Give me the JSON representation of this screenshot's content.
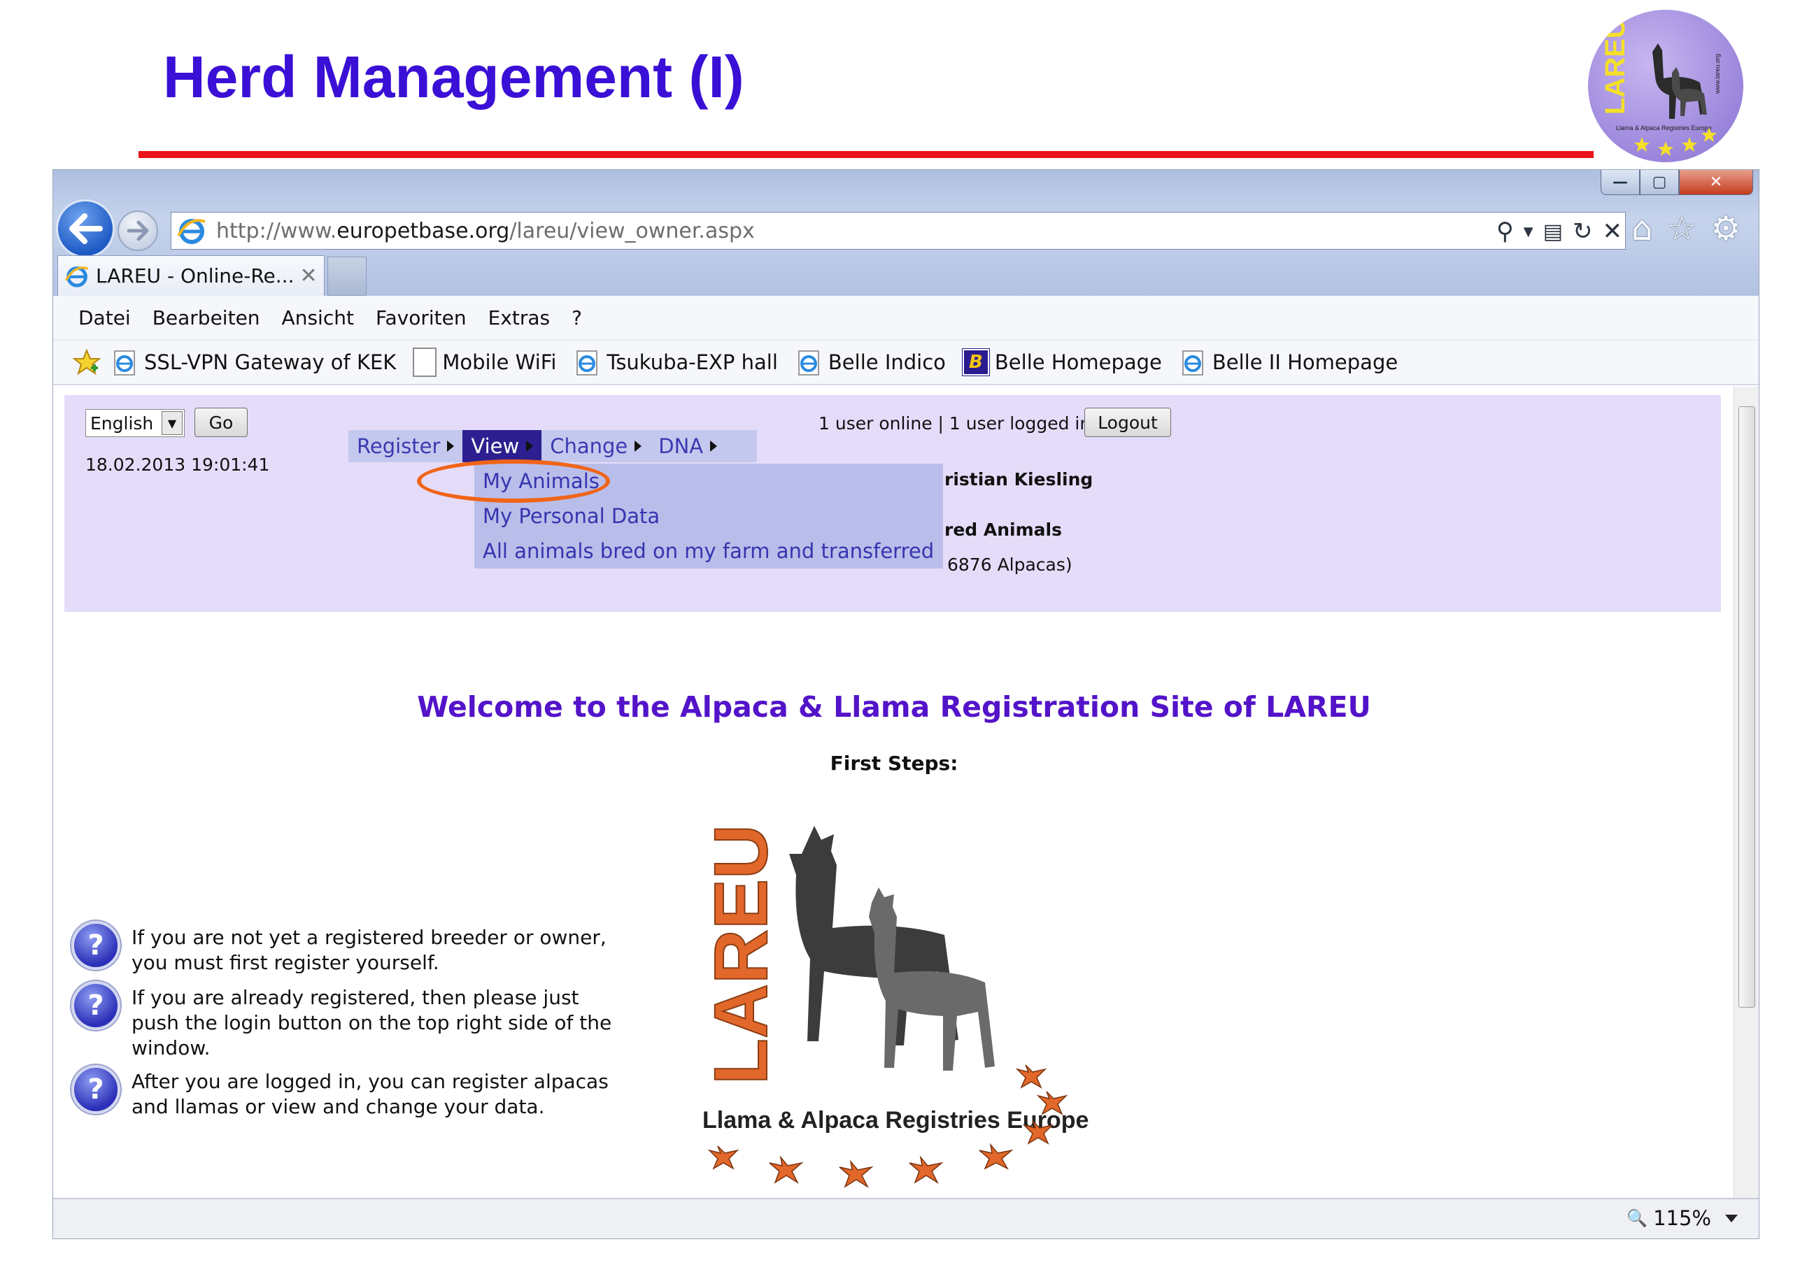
{
  "slide": {
    "title": "Herd Management (I)",
    "badge_text": "LAREU",
    "badge_subtext": "Llama & Alpaca Registries Europe",
    "badge_url": "www.lareu.org"
  },
  "window": {
    "min_label": "—",
    "max_label": "▢",
    "close_label": "✕"
  },
  "address": {
    "url_prefix": "http://www.",
    "url_domain": "europetbase.org",
    "url_path": "/lareu/view_owner.aspx"
  },
  "tab": {
    "title": "LAREU - Online-Re...",
    "close": "✕"
  },
  "menubar": {
    "items": [
      "Datei",
      "Bearbeiten",
      "Ansicht",
      "Favoriten",
      "Extras",
      "?"
    ]
  },
  "favorites": {
    "items": [
      {
        "label": "SSL-VPN Gateway of KEK",
        "icon": "ie-page-icon"
      },
      {
        "label": "Mobile WiFi",
        "icon": "blank-page-icon"
      },
      {
        "label": "Tsukuba-EXP hall",
        "icon": "ie-page-icon"
      },
      {
        "label": "Belle Indico",
        "icon": "ie-page-icon"
      },
      {
        "label": "Belle Homepage",
        "icon": "belle-b-icon"
      },
      {
        "label": "Belle II Homepage",
        "icon": "ie-page-icon"
      }
    ]
  },
  "header": {
    "language": "English",
    "go_label": "Go",
    "datetime": "18.02.2013 19:01:41",
    "users_online": "1 user online | 1 user logged in",
    "logout_label": "Logout",
    "user_name": "ristian Kiesling",
    "registered_animals": "red Animals",
    "alpaca_count": "6876 Alpacas)"
  },
  "nav_menu": {
    "items": [
      "Register",
      "View",
      "Change",
      "DNA"
    ],
    "active": "View",
    "dropdown": [
      "My Animals",
      "My Personal Data",
      "All animals bred on my farm and transferred"
    ]
  },
  "main": {
    "welcome": "Welcome to the Alpaca & Llama Registration Site of LAREU",
    "first_steps": "First Steps:",
    "steps": [
      "If you are not yet a registered breeder or owner, you must first register yourself.",
      "If you are already registered, then please just push the login button on the top right side of the window.",
      "After you are logged in, you can register alpacas and llamas or view and change your data."
    ],
    "logo_text": "LAREU",
    "logo_caption": "Llama & Alpaca Registries Europe"
  },
  "status": {
    "zoom": "115%"
  },
  "colors": {
    "title": "#3a0fd6",
    "rule": "#e8151b",
    "welcome": "#5313c9",
    "header_panel": "#e5dcfa",
    "menu_active": "#2d1f8f",
    "highlight_circle": "#f06418",
    "logo_orange": "#e2672a"
  }
}
